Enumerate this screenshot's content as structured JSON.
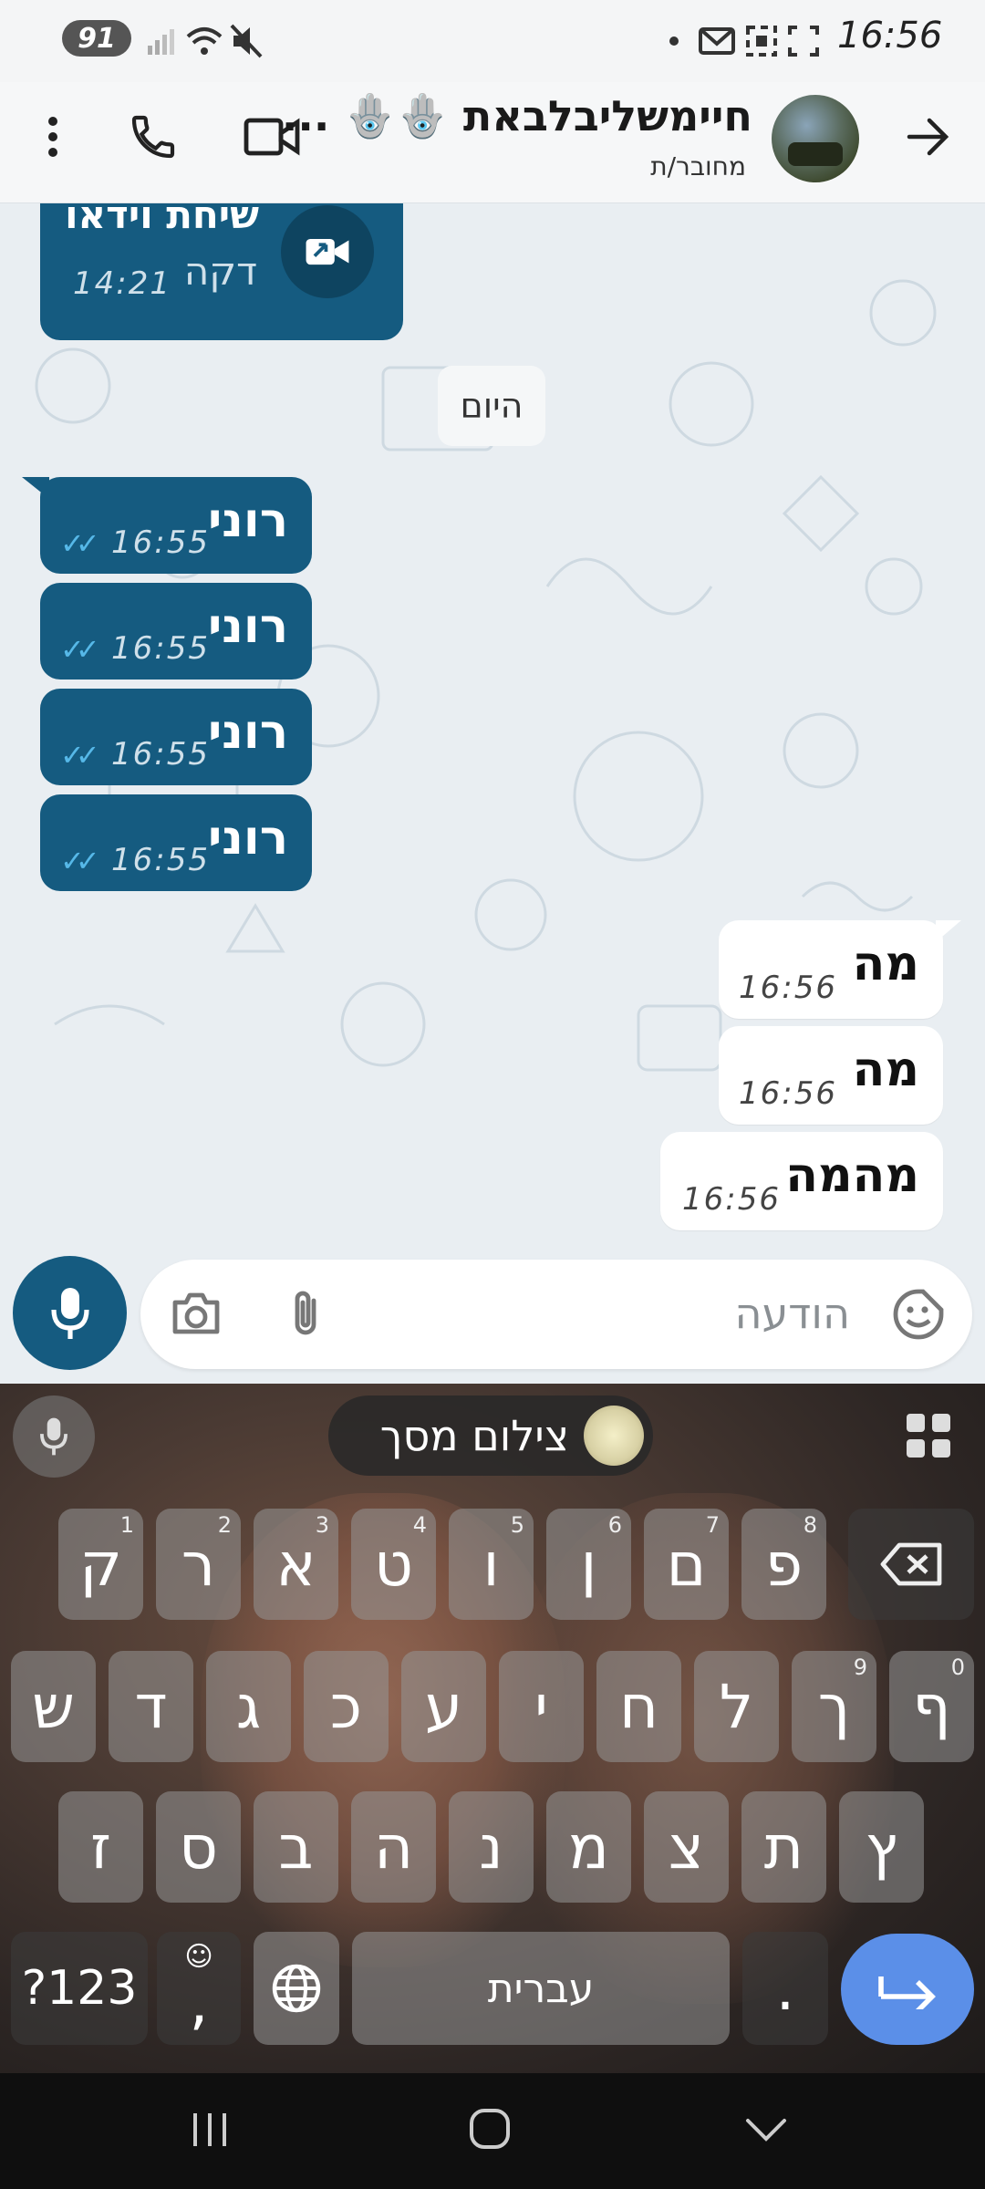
{
  "status_bar": {
    "time": "16:56",
    "battery": "91"
  },
  "header": {
    "contact_name": "חיימשליבלבאת 🪬🪬 ...",
    "status": "מחובר/ת"
  },
  "chat": {
    "top_partial_bubble": {
      "title": "שיחת וידאו",
      "duration": "דקה",
      "time": "14:21"
    },
    "date_chip": "היום",
    "outgoing": [
      {
        "text": "רוני",
        "time": "16:55"
      },
      {
        "text": "רוני",
        "time": "16:55"
      },
      {
        "text": "רוני",
        "time": "16:55"
      },
      {
        "text": "רוני",
        "time": "16:55"
      }
    ],
    "incoming": [
      {
        "text": "מה",
        "time": "16:56"
      },
      {
        "text": "מה",
        "time": "16:56"
      },
      {
        "text": "מהמה",
        "time": "16:56"
      }
    ]
  },
  "composer": {
    "placeholder": "הודעה"
  },
  "keyboard": {
    "toolbar_label": "צילום מסך",
    "row1": [
      {
        "label": "ק",
        "num": "1"
      },
      {
        "label": "ר",
        "num": "2"
      },
      {
        "label": "א",
        "num": "3"
      },
      {
        "label": "ט",
        "num": "4"
      },
      {
        "label": "ו",
        "num": "5"
      },
      {
        "label": "ן",
        "num": "6"
      },
      {
        "label": "ם",
        "num": "7"
      },
      {
        "label": "פ",
        "num": "8"
      }
    ],
    "row2": [
      {
        "label": "ש"
      },
      {
        "label": "ד"
      },
      {
        "label": "ג"
      },
      {
        "label": "כ"
      },
      {
        "label": "ע"
      },
      {
        "label": "י"
      },
      {
        "label": "ח"
      },
      {
        "label": "ל"
      },
      {
        "label": "ך",
        "num": "9"
      },
      {
        "label": "ף",
        "num": "0"
      }
    ],
    "row3": [
      {
        "label": "ז"
      },
      {
        "label": "ס"
      },
      {
        "label": "ב"
      },
      {
        "label": "ה"
      },
      {
        "label": "נ"
      },
      {
        "label": "מ"
      },
      {
        "label": "צ"
      },
      {
        "label": "ת"
      },
      {
        "label": "ץ"
      }
    ],
    "symbols_key": "?123",
    "comma_key": ",",
    "space_key": "עברית",
    "period_key": "."
  },
  "colors": {
    "outgoing_bubble": "#155b80",
    "incoming_bubble": "#ffffff",
    "read_ticks": "#56b8e8",
    "enter_key": "#5b8fe8"
  }
}
